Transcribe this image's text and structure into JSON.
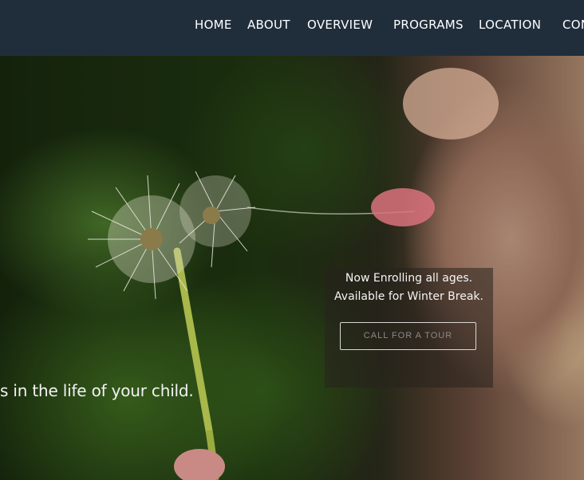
{
  "nav": {
    "items": [
      {
        "label": "HOME"
      },
      {
        "label": "ABOUT"
      },
      {
        "label": "OVERVIEW"
      },
      {
        "label": "PROGRAMS"
      },
      {
        "label": "LOCATION"
      },
      {
        "label": "CON"
      }
    ]
  },
  "hero": {
    "tagline": "s in the life of your child.",
    "promo": {
      "line1": "Now Enrolling all ages.",
      "line2": "Available for Winter Break.",
      "button_label": "CALL FOR A TOUR"
    }
  },
  "colors": {
    "nav_background": "#202e3c",
    "nav_text": "#ffffff",
    "promo_button_border": "#d8d8d8"
  }
}
